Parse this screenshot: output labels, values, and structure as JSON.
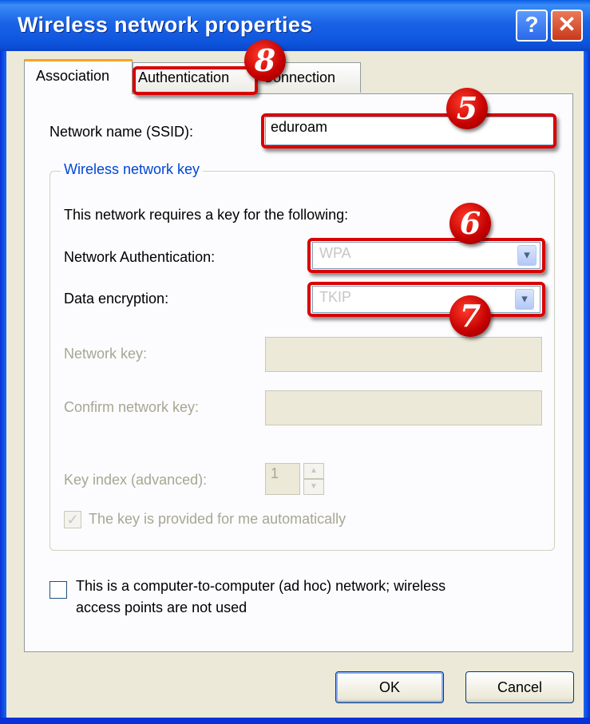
{
  "window": {
    "title": "Wireless network properties",
    "help": "?",
    "close": "✕"
  },
  "tabs": [
    {
      "label": "Association"
    },
    {
      "label": "Authentication"
    },
    {
      "label": "Connection"
    }
  ],
  "association": {
    "ssid_label": "Network name (SSID):",
    "ssid_value": "eduroam",
    "group_title": "Wireless network key",
    "key_requirement_text": "This network requires a key for the following:",
    "net_auth_label": "Network Authentication:",
    "net_auth_value": "WPA",
    "data_enc_label": "Data encryption:",
    "data_enc_value": "TKIP",
    "network_key_label": "Network key:",
    "confirm_key_label": "Confirm network key:",
    "key_index_label": "Key index (advanced):",
    "key_index_value": "1",
    "auto_key_label": "The key is provided for me automatically",
    "adhoc_label_line1": "This is a computer-to-computer (ad hoc) network; wireless",
    "adhoc_label_line2": "access points are not used"
  },
  "buttons": {
    "ok": "OK",
    "cancel": "Cancel"
  },
  "markers": {
    "ssid": "5",
    "auth": "6",
    "encryption": "7",
    "auth_tab": "8"
  },
  "colors": {
    "highlight": "#d90000",
    "title_bar": "#0d54dc",
    "group_title": "#0046d5"
  }
}
